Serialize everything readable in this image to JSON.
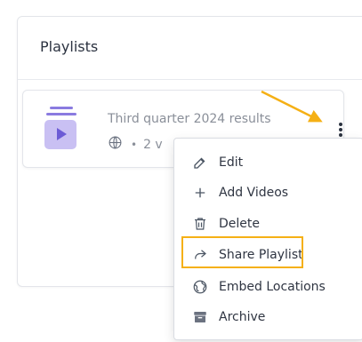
{
  "panel": {
    "title": "Playlists"
  },
  "playlist": {
    "title": "Third quarter 2024 results",
    "meta_visible": "2 v",
    "separator": "•"
  },
  "menu": {
    "items": [
      {
        "label": "Edit",
        "icon": "edit-icon"
      },
      {
        "label": "Add Videos",
        "icon": "plus-icon"
      },
      {
        "label": "Delete",
        "icon": "trash-icon"
      },
      {
        "label": "Share Playlist",
        "icon": "share-icon",
        "highlighted": true
      },
      {
        "label": "Embed Locations",
        "icon": "globe-icon"
      },
      {
        "label": "Archive",
        "icon": "archive-icon"
      }
    ]
  },
  "colors": {
    "annotation": "#f5b015",
    "thumbnail_bg": "#c9c0f3",
    "thumbnail_accent": "#6c5bd6"
  }
}
